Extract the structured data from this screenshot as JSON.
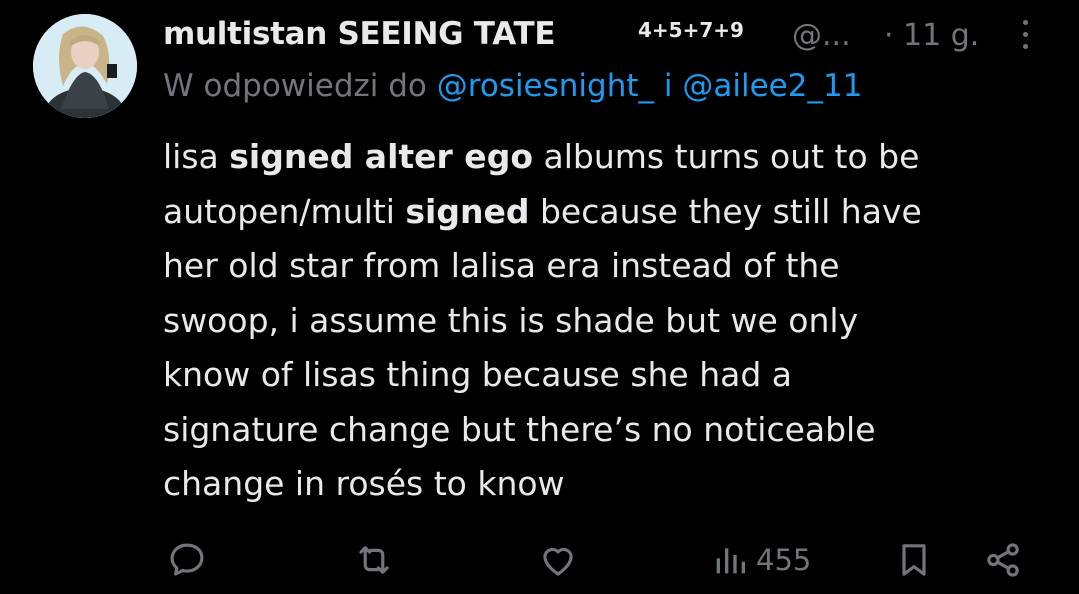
{
  "tweet": {
    "display_name": "multistan SEEING TATE",
    "name_superscript": "4+5+7+9",
    "handle": "@...",
    "separator": "·",
    "time": "11 g.",
    "reply_prefix": "W odpowiedzi do",
    "reply_mention_1": "@rosiesnight_",
    "reply_conjunction": "i",
    "reply_mention_2": "@ailee2_11",
    "body_lines": [
      [
        {
          "t": "lisa "
        },
        {
          "t": "signed alter ego",
          "b": true
        },
        {
          "t": " albums turns out to be"
        }
      ],
      [
        {
          "t": "autopen/multi "
        },
        {
          "t": "signed",
          "b": true
        },
        {
          "t": " because they still have"
        }
      ],
      [
        {
          "t": "her old star from lalisa era instead of the"
        }
      ],
      [
        {
          "t": "swoop, i assume this is shade but we only"
        }
      ],
      [
        {
          "t": "know of lisas thing because she had a"
        }
      ],
      [
        {
          "t": "signature change but there’s no noticeable"
        }
      ],
      [
        {
          "t": "change in rosés to know"
        }
      ]
    ]
  },
  "actions": {
    "views_count": "455"
  },
  "colors": {
    "background": "#000000",
    "text_primary": "#e7e9ea",
    "text_secondary": "#71767b",
    "accent": "#1d9bf0"
  },
  "icons": [
    "avatar-photo",
    "more-options-icon",
    "reply-icon",
    "retweet-icon",
    "like-icon",
    "views-icon",
    "bookmark-icon",
    "share-icon"
  ]
}
